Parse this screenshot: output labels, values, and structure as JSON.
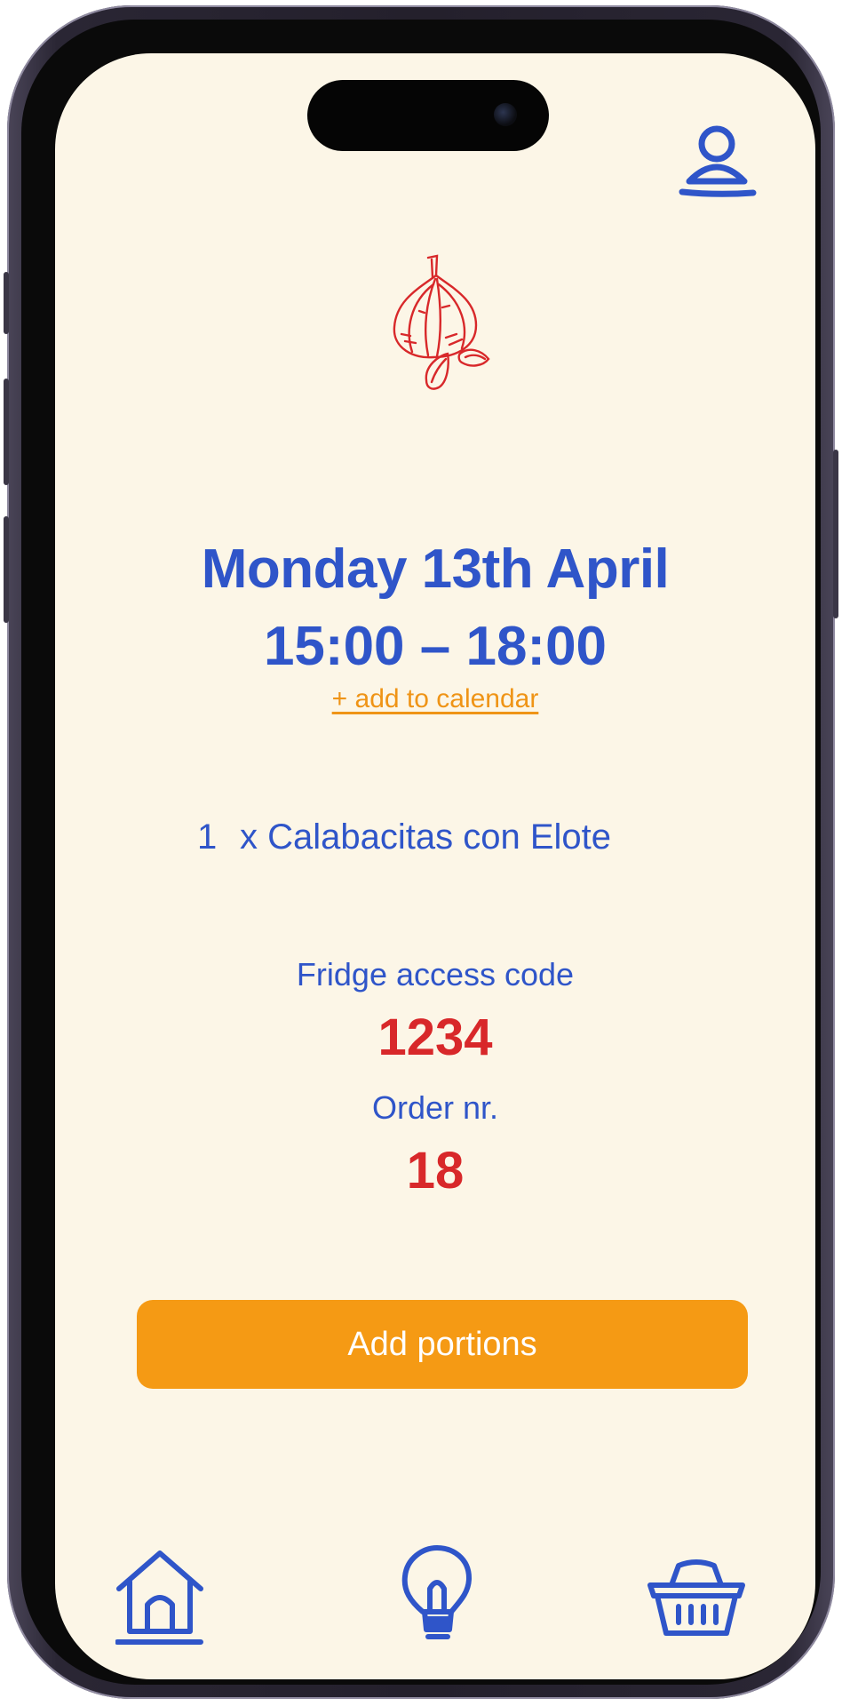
{
  "header": {
    "profile_icon": "user-profile-icon"
  },
  "hero": {
    "icon": "garlic-icon",
    "accent_color": "#d8282a"
  },
  "pickup": {
    "date": "Monday 13th April",
    "time": "15:00 – 18:00",
    "add_to_calendar": "+ add to calendar"
  },
  "order_items": [
    {
      "quantity": "1",
      "name": "x Calabacitas con Elote"
    }
  ],
  "fridge": {
    "label": "Fridge access code",
    "code": "1234"
  },
  "order": {
    "label": "Order nr.",
    "number": "18"
  },
  "actions": {
    "add_portions": "Add portions"
  },
  "bottom_nav": [
    {
      "icon": "home-icon",
      "active": true
    },
    {
      "icon": "lightbulb-icon",
      "active": false
    },
    {
      "icon": "basket-icon",
      "active": false
    }
  ],
  "colors": {
    "primary": "#2f55c9",
    "accent": "#f59a14",
    "highlight": "#d8282a",
    "background": "#fcf6e7"
  }
}
